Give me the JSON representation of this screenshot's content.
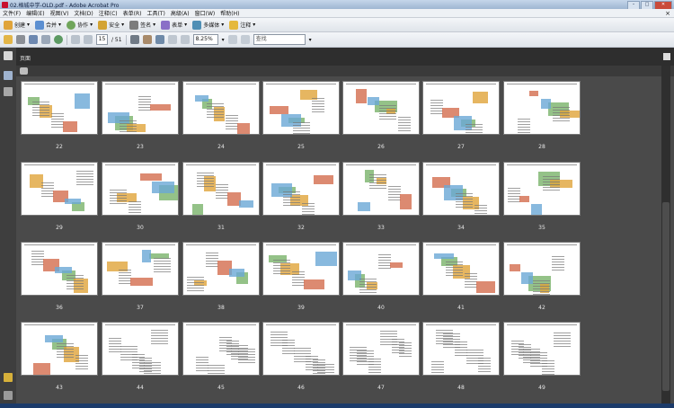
{
  "window": {
    "title": "02.格城中学-OLD.pdf - Adobe Acrobat Pro",
    "close_glyph": "✕",
    "min_glyph": "–",
    "max_glyph": "□"
  },
  "menu": [
    "文件(F)",
    "编辑(E)",
    "视图(V)",
    "文档(D)",
    "注释(C)",
    "表单(R)",
    "工具(T)",
    "高级(A)",
    "窗口(W)",
    "帮助(H)"
  ],
  "menu_close_glyph": "×",
  "toolbar1": {
    "create": "创建",
    "combine": "合并",
    "collaborate": "协作",
    "secure": "安全",
    "sign": "签名",
    "forms": "表单",
    "multimedia": "多媒体",
    "comment": "注释"
  },
  "toolbar2": {
    "page_current": "15",
    "page_total": "/ 51",
    "zoom": "8.25%",
    "find_placeholder": "查找"
  },
  "panel": {
    "title": "页面"
  },
  "colors": {
    "accent_red": "#c8102e",
    "chrome_dark": "#3a3a3a"
  },
  "thumbnails": [
    {
      "label": "22"
    },
    {
      "label": "23"
    },
    {
      "label": "24"
    },
    {
      "label": "25"
    },
    {
      "label": "26"
    },
    {
      "label": "27"
    },
    {
      "label": "28"
    },
    {
      "label": "29"
    },
    {
      "label": "30"
    },
    {
      "label": "31"
    },
    {
      "label": "32"
    },
    {
      "label": "33"
    },
    {
      "label": "34"
    },
    {
      "label": "35"
    },
    {
      "label": "36"
    },
    {
      "label": "37"
    },
    {
      "label": "38"
    },
    {
      "label": "39"
    },
    {
      "label": "40"
    },
    {
      "label": "41"
    },
    {
      "label": "42"
    },
    {
      "label": "43"
    },
    {
      "label": "44"
    },
    {
      "label": "45"
    },
    {
      "label": "46"
    },
    {
      "label": "47"
    },
    {
      "label": "48"
    },
    {
      "label": "49"
    }
  ]
}
